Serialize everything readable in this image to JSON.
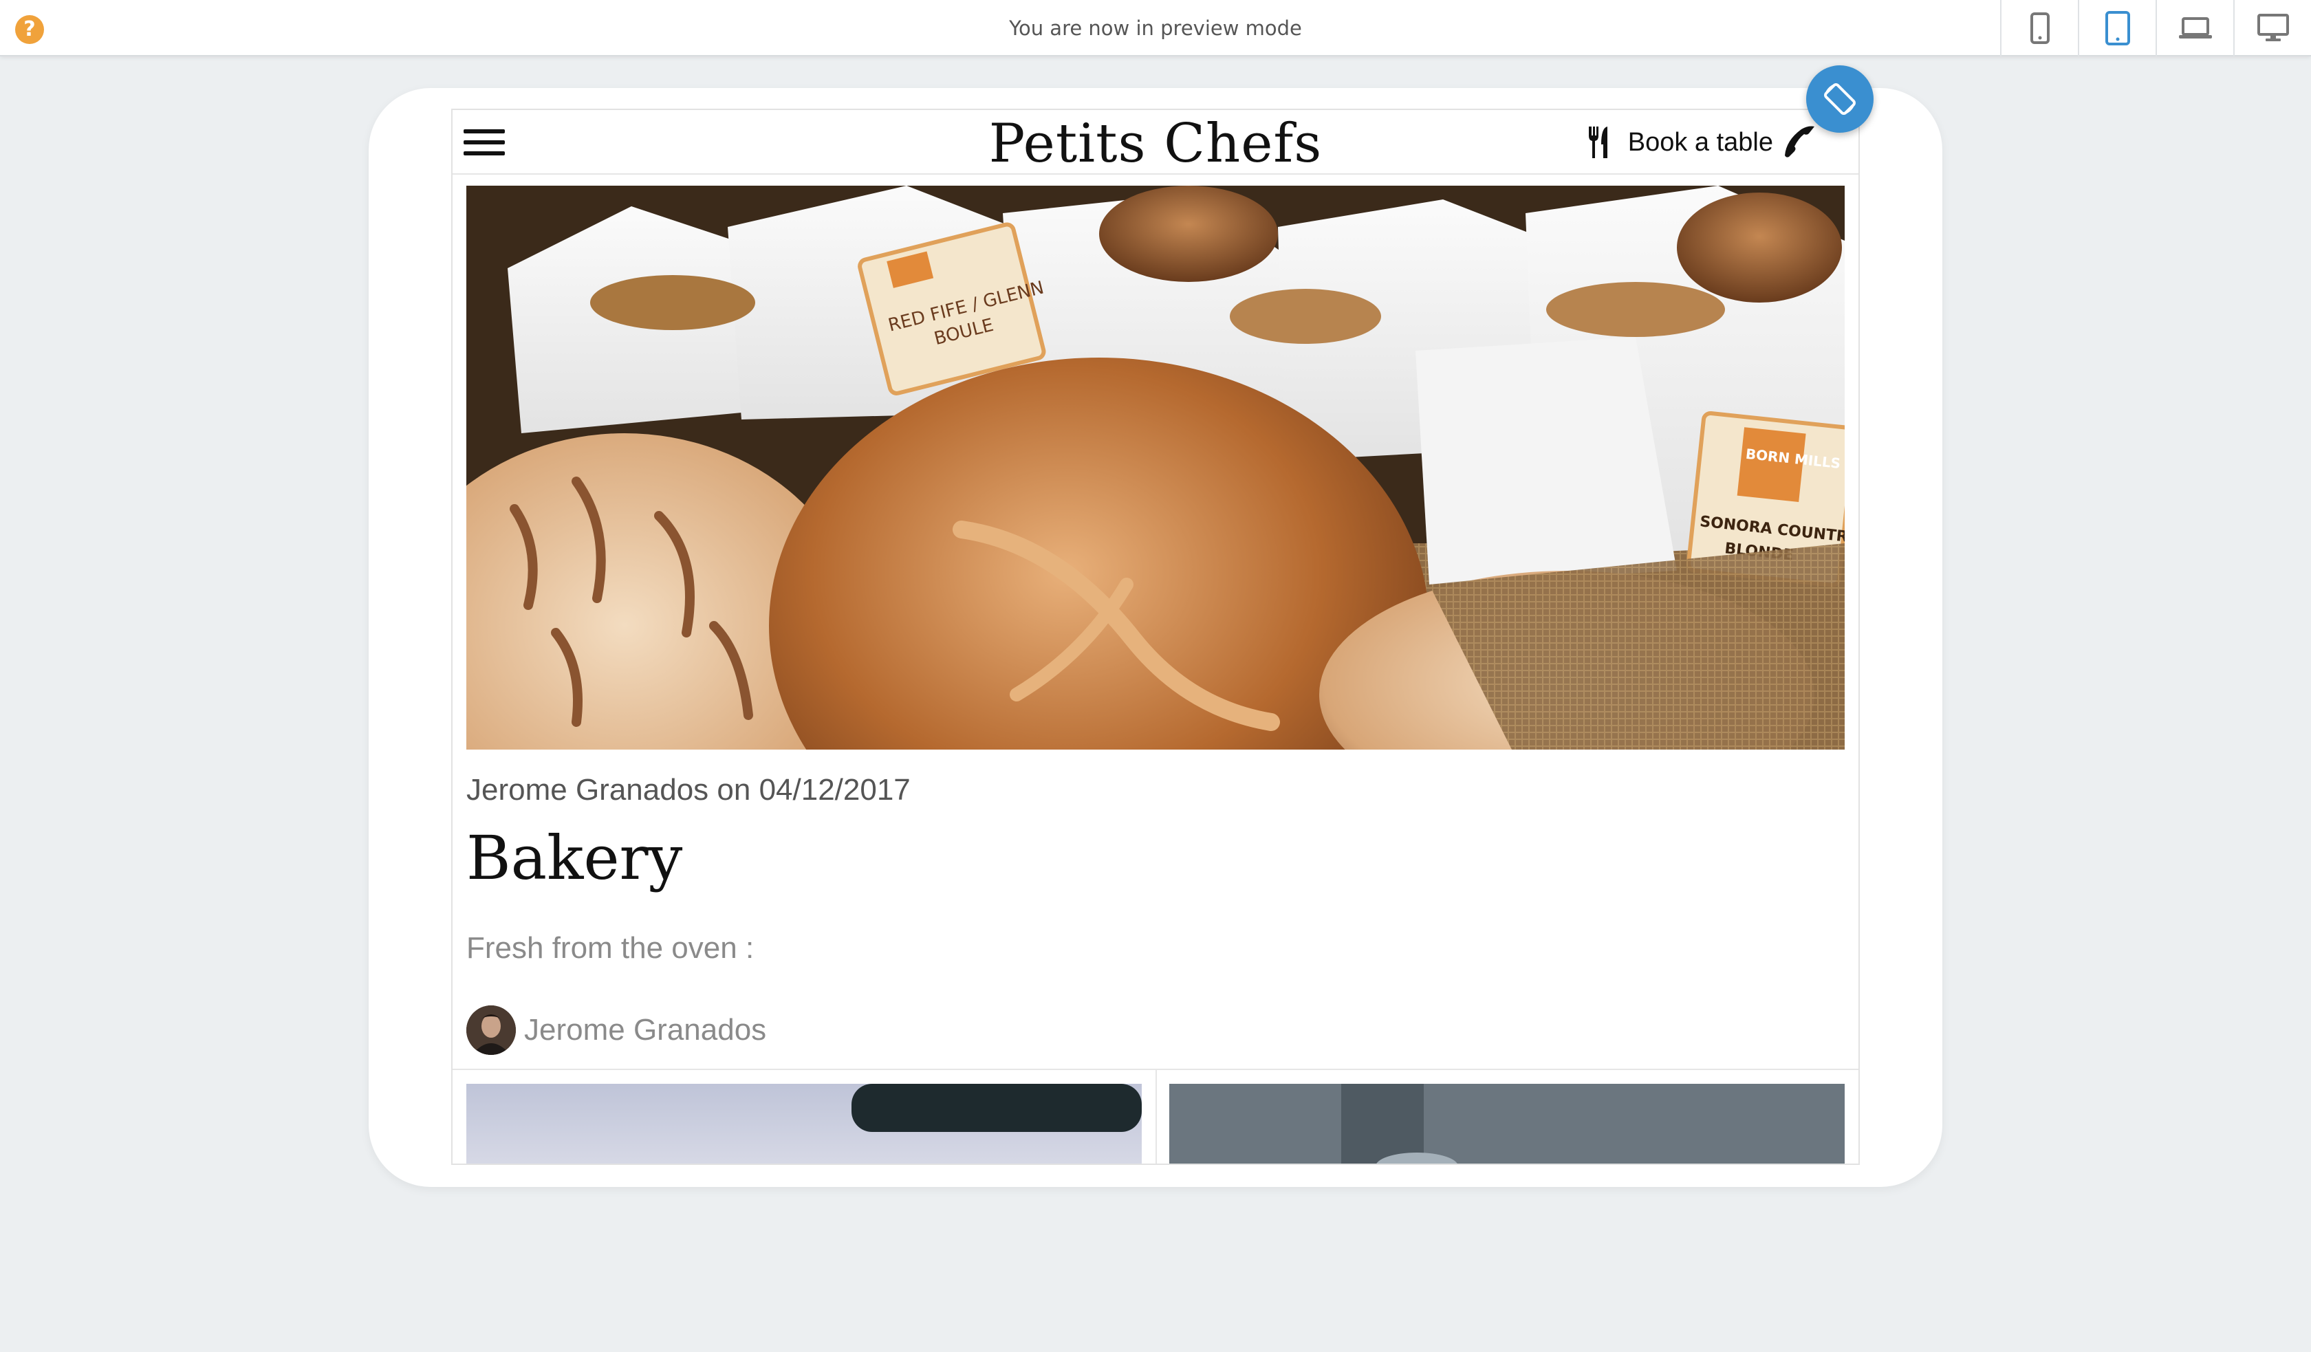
{
  "toolbar": {
    "help_glyph": "?",
    "message": "You are now in preview mode",
    "devices": [
      {
        "name": "mobile",
        "icon": "phone-device-icon",
        "active": false
      },
      {
        "name": "tablet",
        "icon": "tablet-device-icon",
        "active": true
      },
      {
        "name": "laptop",
        "icon": "laptop-device-icon",
        "active": false
      },
      {
        "name": "desktop",
        "icon": "desktop-device-icon",
        "active": false
      }
    ],
    "active_color": "#3a8fd0",
    "inactive_color": "#777777"
  },
  "site": {
    "brand": "Petits Chefs",
    "book_label": "Book a table",
    "post": {
      "meta": "Jerome Granados on 04/12/2017",
      "title": "Bakery",
      "excerpt": "Fresh from the oven :",
      "author": "Jerome Granados"
    }
  },
  "hero_image": {
    "tags": [
      {
        "line1": "RED FIFE / GLENN",
        "line2": "BOULE"
      },
      {
        "line1": "SONORA COUNTRY",
        "line2": "BLONDE"
      }
    ],
    "brand_text": "BORN MILLS"
  }
}
